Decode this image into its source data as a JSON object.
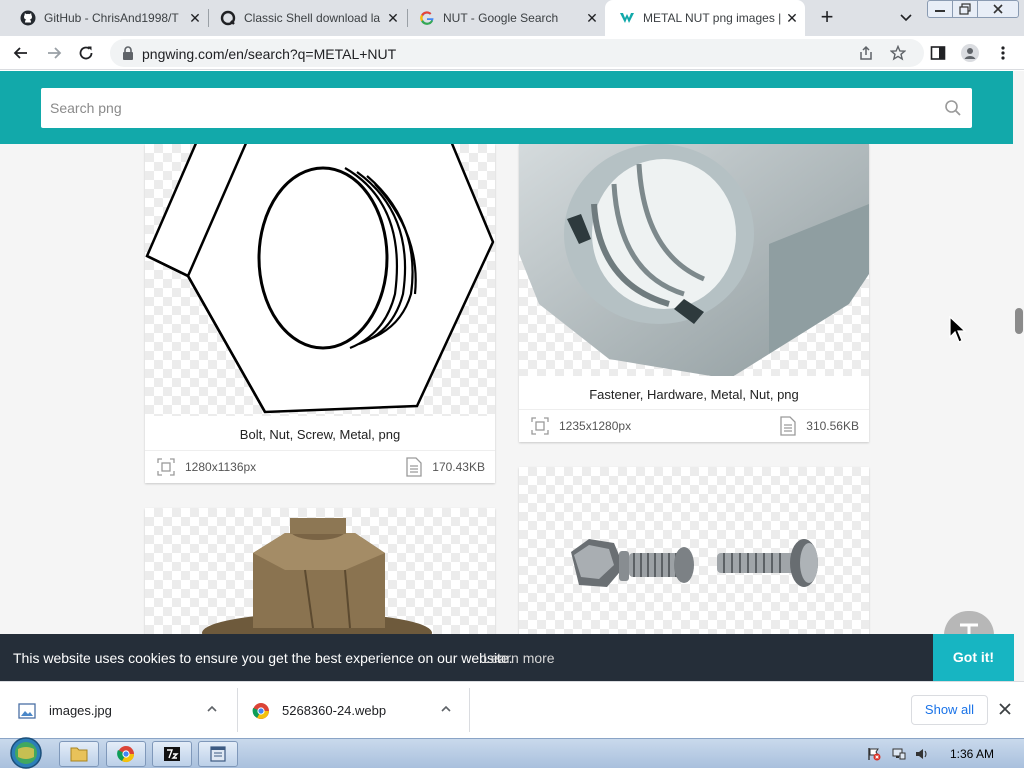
{
  "browser": {
    "tabs": [
      {
        "title": "GitHub - ChrisAnd1998/T",
        "icon": "github-icon",
        "active": false
      },
      {
        "title": "Classic Shell download la",
        "icon": "classic-shell-icon",
        "active": false
      },
      {
        "title": "NUT - Google Search",
        "icon": "google-icon",
        "active": false
      },
      {
        "title": "METAL NUT png images |",
        "icon": "pngwing-icon",
        "active": true
      }
    ],
    "new_tab_label": "+",
    "address": "pngwing.com/en/search?q=METAL+NUT"
  },
  "site": {
    "search_placeholder": "Search png",
    "accent_color": "#12a9aa"
  },
  "results": [
    {
      "title": "Bolt, Nut, Screw, Metal, png",
      "dimensions": "1280x1136px",
      "size": "170.43KB"
    },
    {
      "title": "Fastener, Hardware, Metal, Nut, png",
      "dimensions": "1235x1280px",
      "size": "310.56KB"
    },
    {
      "title": "",
      "dimensions": "",
      "size": ""
    },
    {
      "title": "",
      "dimensions": "",
      "size": ""
    }
  ],
  "cookie_banner": {
    "text": "This website uses cookies to ensure you get the best experience on our website.",
    "learn_more": "Learn more",
    "accept": "Got it!"
  },
  "downloads": {
    "items": [
      {
        "name": "images.jpg",
        "icon": "image-file-icon"
      },
      {
        "name": "5268360-24.webp",
        "icon": "chrome-file-icon"
      }
    ],
    "show_all": "Show all"
  },
  "taskbar": {
    "clock": "1:36 AM"
  }
}
